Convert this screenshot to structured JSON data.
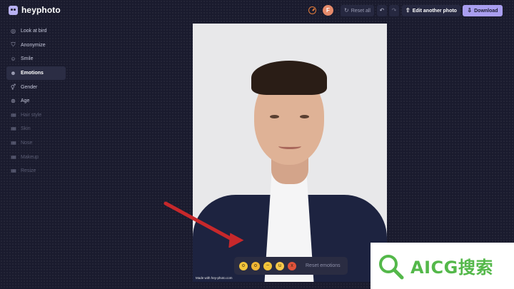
{
  "app": {
    "name": "heyphoto"
  },
  "header": {
    "avatar_letter": "F",
    "reset_label": "Reset all",
    "edit_label": "Edit another photo",
    "download_label": "Download"
  },
  "sidebar": {
    "items": [
      {
        "label": "Look at bird",
        "icon": "eye-icon",
        "state": "normal"
      },
      {
        "label": "Anonymize",
        "icon": "mask-icon",
        "state": "normal"
      },
      {
        "label": "Smile",
        "icon": "smile-icon",
        "state": "normal"
      },
      {
        "label": "Emotions",
        "icon": "emotions-icon",
        "state": "active"
      },
      {
        "label": "Gender",
        "icon": "gender-icon",
        "state": "normal"
      },
      {
        "label": "Age",
        "icon": "age-icon",
        "state": "normal"
      },
      {
        "label": "Hair style",
        "icon": "locked-icon",
        "state": "disabled"
      },
      {
        "label": "Skin",
        "icon": "locked-icon",
        "state": "disabled"
      },
      {
        "label": "Nose",
        "icon": "locked-icon",
        "state": "disabled"
      },
      {
        "label": "Makeup",
        "icon": "locked-icon",
        "state": "disabled"
      },
      {
        "label": "Resize",
        "icon": "locked-icon",
        "state": "disabled"
      }
    ]
  },
  "photo": {
    "caption": "Made with hey-photo.com"
  },
  "emotions": {
    "options": [
      {
        "name": "surprised-emoji",
        "glyph": "o"
      },
      {
        "name": "shocked-emoji",
        "glyph": "o"
      },
      {
        "name": "sad-emoji",
        "glyph": "~"
      },
      {
        "name": "happy-emoji",
        "glyph": "u"
      },
      {
        "name": "angry-emoji",
        "glyph": "x"
      }
    ],
    "reset_label": "Reset emotions"
  },
  "overlay": {
    "watermark_text": "AICG搜索"
  },
  "colors": {
    "background": "#1a1b2e",
    "accent": "#a99ef0",
    "arrow": "#c7282b",
    "watermark_green": "#54b84a"
  }
}
